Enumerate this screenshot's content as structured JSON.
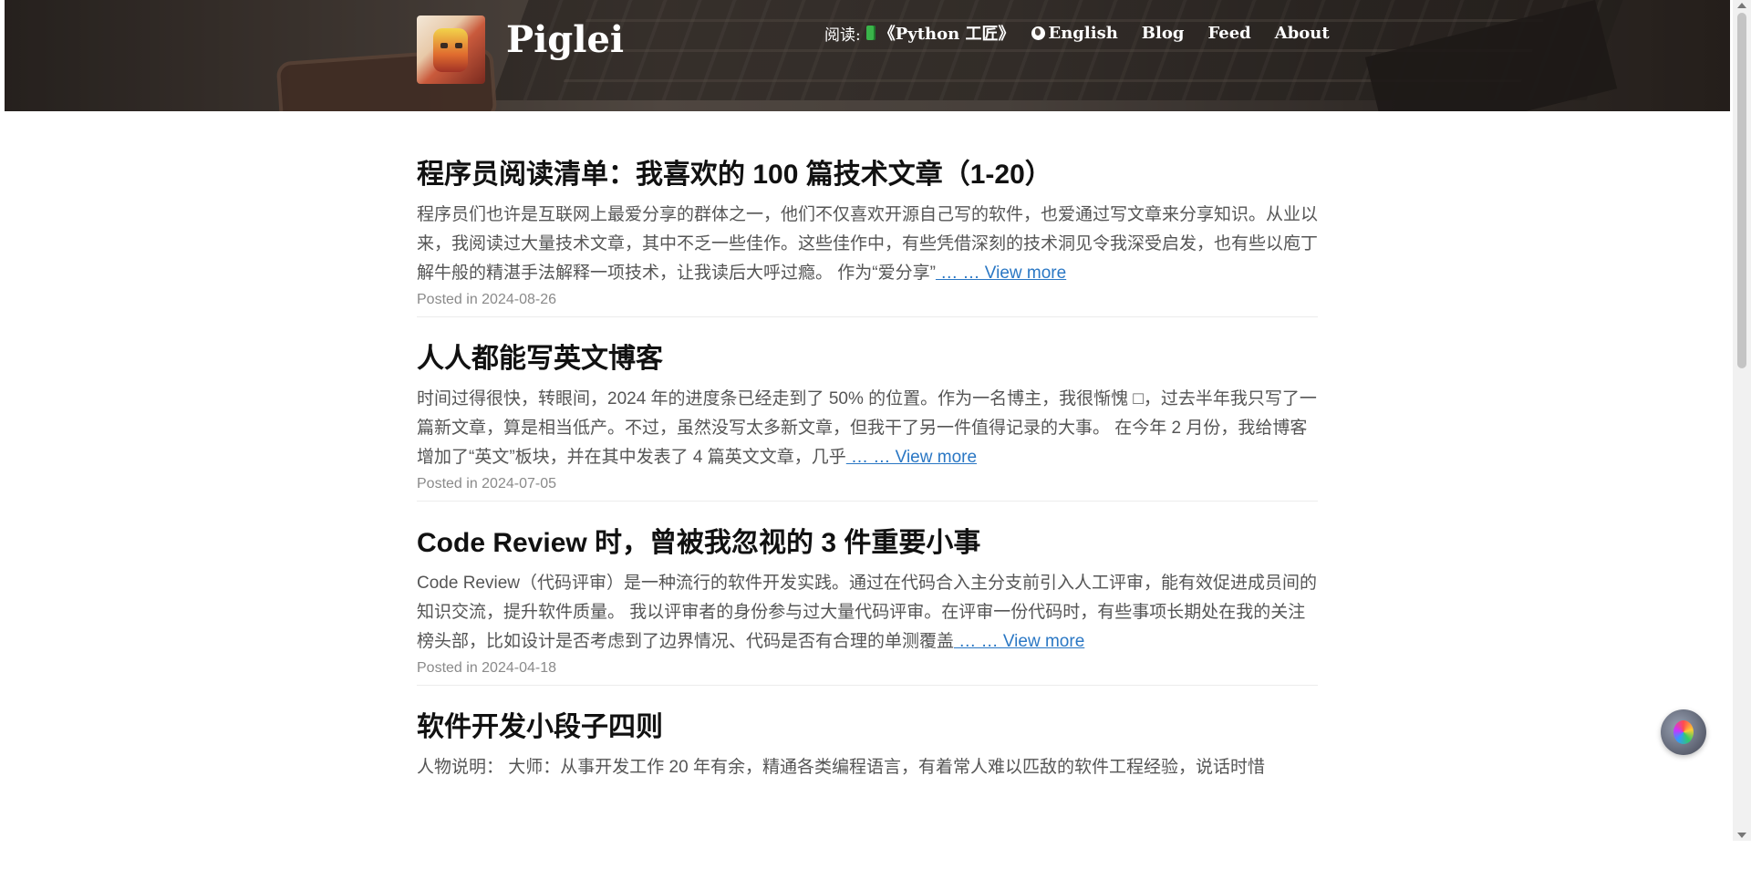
{
  "header": {
    "site_title": "Piglei",
    "nav": {
      "read_label": "阅读:",
      "book_link": "《Python 工匠》",
      "english": "English",
      "blog": "Blog",
      "feed": "Feed",
      "about": "About"
    }
  },
  "posts": [
    {
      "title": "程序员阅读清单：我喜欢的 100 篇技术文章（1-20）",
      "excerpt": "程序员们也许是互联网上最爱分享的群体之一，他们不仅喜欢开源自己写的软件，也爱通过写文章来分享知识。从业以来，我阅读过大量技术文章，其中不乏一些佳作。这些佳作中，有些凭借深刻的技术洞见令我深受启发，也有些以庖丁解牛般的精湛手法解释一项技术，让我读后大呼过瘾。 作为“爱分享”",
      "more": " … … View more",
      "date": "Posted in 2024-08-26"
    },
    {
      "title": "人人都能写英文博客",
      "excerpt": "时间过得很快，转眼间，2024 年的进度条已经走到了 50% 的位置。作为一名博主，我很惭愧 □，过去半年我只写了一篇新文章，算是相当低产。不过，虽然没写太多新文章，但我干了另一件值得记录的大事。 在今年 2 月份，我给博客增加了“英文”板块，并在其中发表了 4 篇英文文章，几乎",
      "more": " … … View more",
      "date": "Posted in 2024-07-05"
    },
    {
      "title": "Code Review 时，曾被我忽视的 3 件重要小事",
      "excerpt": "Code Review（代码评审）是一种流行的软件开发实践。通过在代码合入主分支前引入人工评审，能有效促进成员间的知识交流，提升软件质量。 我以评审者的身份参与过大量代码评审。在评审一份代码时，有些事项长期处在我的关注榜头部，比如设计是否考虑到了边界情况、代码是否有合理的单测覆盖",
      "more": " … … View more",
      "date": "Posted in 2024-04-18"
    },
    {
      "title": "软件开发小段子四则",
      "excerpt": "人物说明： 大师：从事开发工作 20 年有余，精通各类编程语言，有着常人难以匹敌的软件工程经验，说话时惜",
      "more": "",
      "date": ""
    }
  ]
}
